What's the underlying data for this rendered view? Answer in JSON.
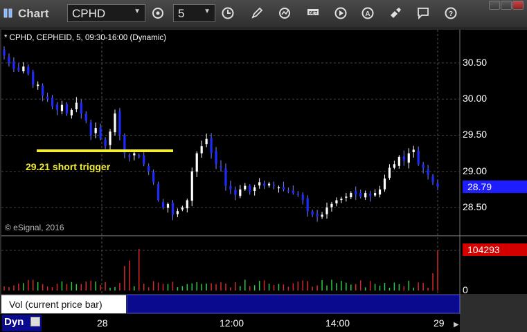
{
  "window": {
    "title": "Chart",
    "min_label": "",
    "max_label": "",
    "close_label": ""
  },
  "toolbar": {
    "symbol": "CPHD",
    "interval": "5",
    "icons": [
      "settings-icon",
      "clock-icon",
      "pencil-icon",
      "refresh-icon",
      "get-icon",
      "play-icon",
      "alert-icon",
      "tools-icon",
      "comment-icon",
      "help-icon"
    ]
  },
  "chart": {
    "header": "* CPHD, CEPHEID, 5, 09:30-16:00 (Dynamic)",
    "copyright": "© eSignal, 2016",
    "annotation": "29.21 short trigger",
    "price_ticks": [
      "30.50",
      "30.00",
      "29.50",
      "29.00",
      "28.50"
    ],
    "last_price": "28.79",
    "volume_last": "104293",
    "volume_zero": "0",
    "time_ticks": [
      "28",
      "12:00",
      "14:00",
      "29"
    ],
    "indicator_label": "Vol (current price bar)",
    "indicator_close": "×",
    "mode_label": "Dyn",
    "colors": {
      "up": "#ffffff",
      "down": "#1e2bff",
      "trigger": "#f2ee37",
      "vol_up": "#2ecc40",
      "vol_down": "#d42a2a",
      "last_price_bg": "#1d1dff",
      "volume_bg": "#d40000"
    }
  },
  "chart_data": {
    "type": "candlestick",
    "trigger_level": 29.21,
    "y_range": [
      28.2,
      30.7
    ],
    "closes": [
      30.6,
      30.5,
      30.42,
      30.4,
      30.45,
      30.35,
      30.2,
      30.2,
      30.05,
      30.0,
      29.9,
      29.85,
      29.92,
      29.8,
      29.85,
      29.95,
      29.8,
      29.7,
      29.5,
      29.6,
      29.45,
      29.35,
      29.55,
      29.8,
      29.5,
      29.25,
      29.2,
      29.25,
      29.2,
      29.1,
      29.0,
      28.85,
      28.6,
      28.5,
      28.55,
      28.4,
      28.45,
      28.5,
      28.6,
      29.0,
      29.25,
      29.35,
      29.45,
      29.25,
      29.1,
      29.05,
      28.8,
      28.75,
      28.68,
      28.75,
      28.8,
      28.72,
      28.78,
      28.85,
      28.8,
      28.83,
      28.8,
      28.78,
      28.75,
      28.72,
      28.7,
      28.68,
      28.6,
      28.45,
      28.4,
      28.38,
      28.4,
      28.5,
      28.55,
      28.6,
      28.62,
      28.65,
      28.7,
      28.68,
      28.65,
      28.7,
      28.66,
      28.7,
      28.75,
      28.9,
      29.05,
      29.1,
      29.2,
      29.15,
      29.25,
      29.3,
      29.1,
      29.05,
      28.95,
      28.85,
      28.79
    ],
    "volume_last": 104293
  }
}
